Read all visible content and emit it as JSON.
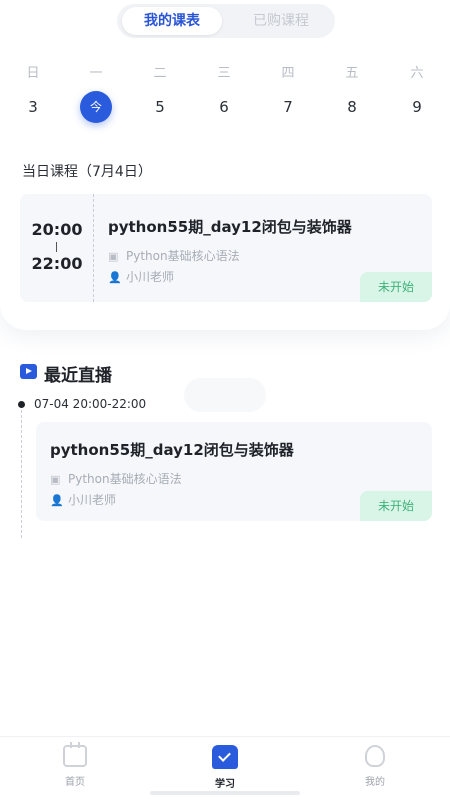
{
  "tabs": {
    "my_schedule": "我的课表",
    "purchased": "已购课程"
  },
  "weekdays": [
    "日",
    "一",
    "二",
    "三",
    "四",
    "五",
    "六"
  ],
  "dates": [
    "3",
    "今",
    "5",
    "6",
    "7",
    "8",
    "9"
  ],
  "today_section": "当日课程（7月4日）",
  "course": {
    "start_time": "20:00",
    "end_time": "22:00",
    "title": "python55期_day12闭包与装饰器",
    "subject": "Python基础核心语法",
    "teacher": "小川老师",
    "status": "未开始"
  },
  "live": {
    "heading": "最近直播",
    "time": "07-04 20:00-22:00",
    "title": "python55期_day12闭包与装饰器",
    "subject": "Python基础核心语法",
    "teacher": "小川老师",
    "status": "未开始"
  },
  "tabbar": {
    "home": "首页",
    "study": "学习",
    "mine": "我的"
  },
  "colors": {
    "accent": "#2a5bdc",
    "status_bg": "#d9f5e7",
    "status_text": "#3fb17a"
  }
}
